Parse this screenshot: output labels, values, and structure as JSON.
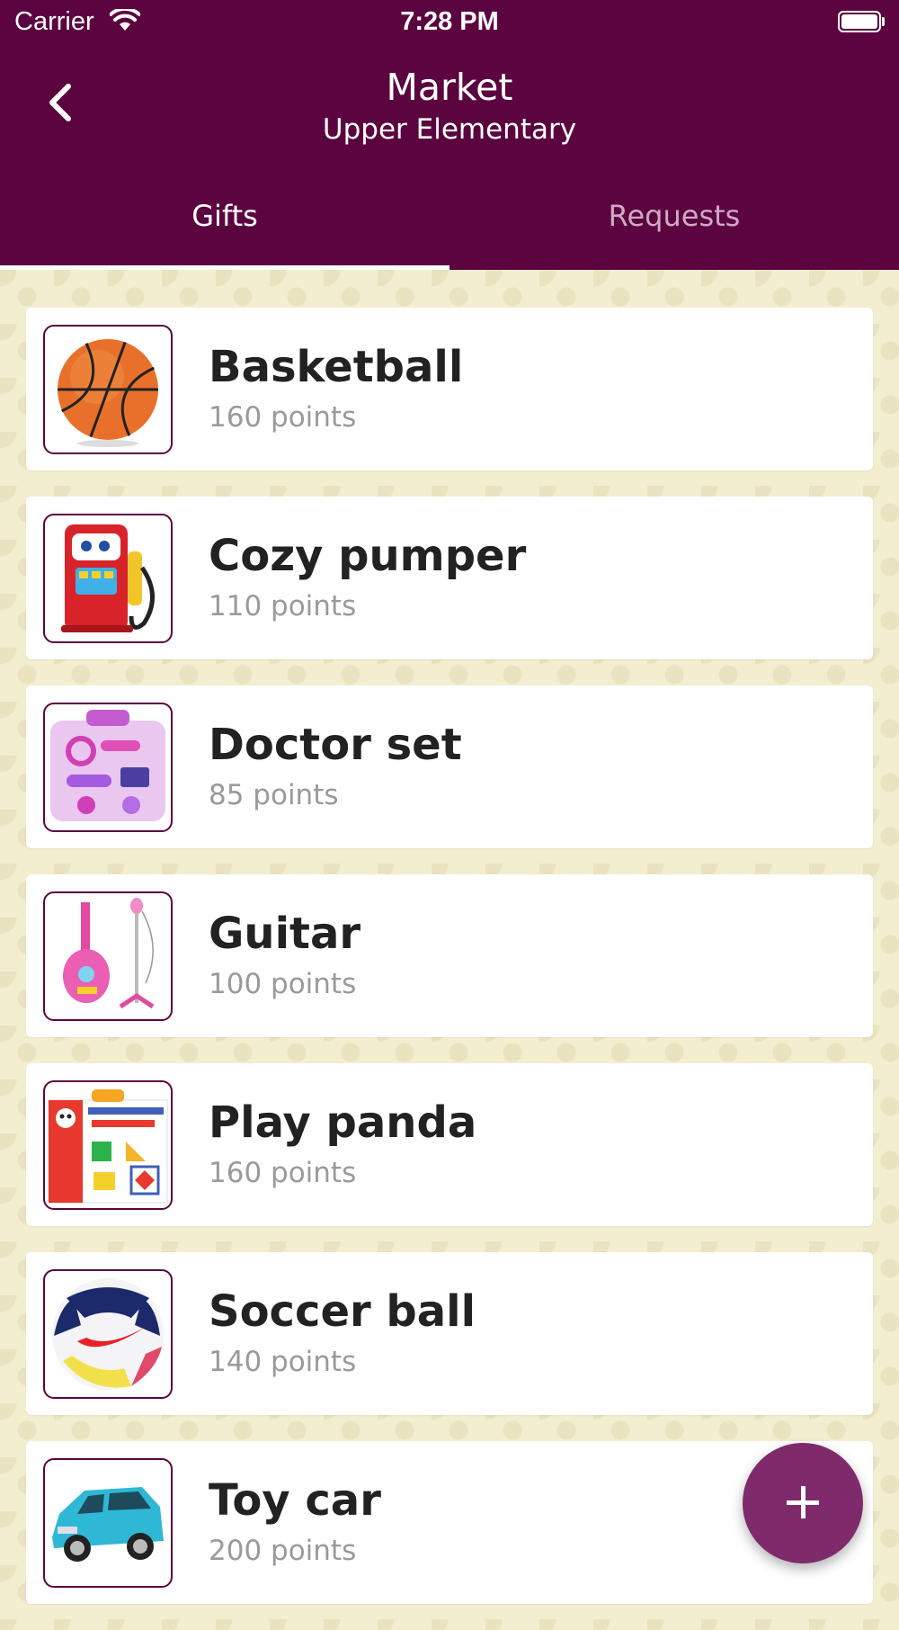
{
  "status_bar": {
    "carrier": "Carrier",
    "time": "7:28 PM"
  },
  "header": {
    "title": "Market",
    "subtitle": "Upper Elementary",
    "back_icon": "chevron-left-icon"
  },
  "tabs": [
    {
      "label": "Gifts",
      "selected": true
    },
    {
      "label": "Requests",
      "selected": false
    }
  ],
  "gifts": [
    {
      "name": "Basketball",
      "points": "160 points",
      "image": "basketball"
    },
    {
      "name": "Cozy pumper",
      "points": "110 points",
      "image": "toy-gas-pump"
    },
    {
      "name": "Doctor set",
      "points": "85 points",
      "image": "toy-doctor-kit"
    },
    {
      "name": "Guitar",
      "points": "100 points",
      "image": "toy-guitar-mic-stand"
    },
    {
      "name": "Play panda",
      "points": "160 points",
      "image": "magnetic-shapes-box"
    },
    {
      "name": "Soccer ball",
      "points": "140 points",
      "image": "soccer-ball"
    },
    {
      "name": "Toy car",
      "points": "200 points",
      "image": "toy-van"
    }
  ],
  "fab": {
    "icon": "plus-icon"
  },
  "colors": {
    "header": "#5b0440",
    "fab": "#7f2b6b",
    "background": "#f3eed0"
  }
}
